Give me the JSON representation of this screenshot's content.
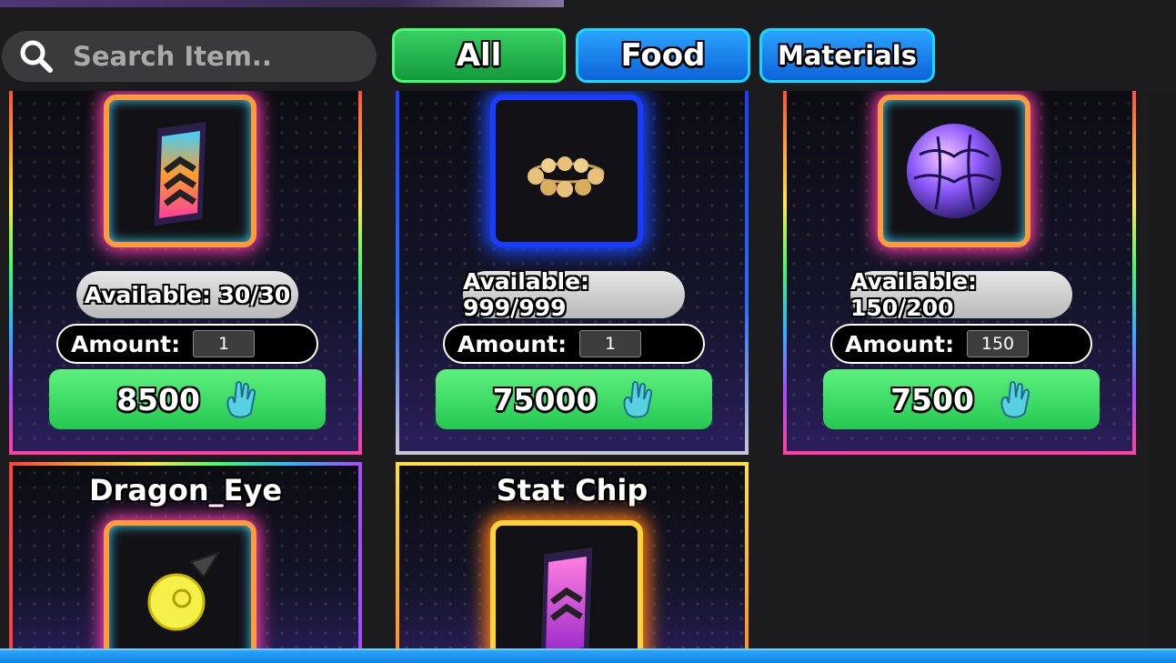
{
  "search": {
    "placeholder": "Search Item.."
  },
  "tabs": [
    {
      "label": "All"
    },
    {
      "label": "Food"
    },
    {
      "label": "Materials"
    }
  ],
  "items": [
    {
      "name": "",
      "available": "Available: 30/30",
      "amount_label": "Amount:",
      "amount_value": "1",
      "price": "8500",
      "icon": "stat-chip-rainbow-icon"
    },
    {
      "name": "",
      "available": "Available: 999/999",
      "amount_label": "Amount:",
      "amount_value": "1",
      "price": "75000",
      "icon": "golden-beads-icon"
    },
    {
      "name": "",
      "available": "Available: 150/200",
      "amount_label": "Amount:",
      "amount_value": "150",
      "price": "7500",
      "icon": "cosmic-orb-icon"
    },
    {
      "name": "Dragon_Eye",
      "icon": "dragon-eye-icon"
    },
    {
      "name": "Stat Chip",
      "icon": "stat-chip-pink-icon"
    }
  ],
  "colors": {
    "buy_green": "#2ecc5a",
    "tab_all": "#1fae48",
    "tab_blue": "#1a7dff"
  }
}
